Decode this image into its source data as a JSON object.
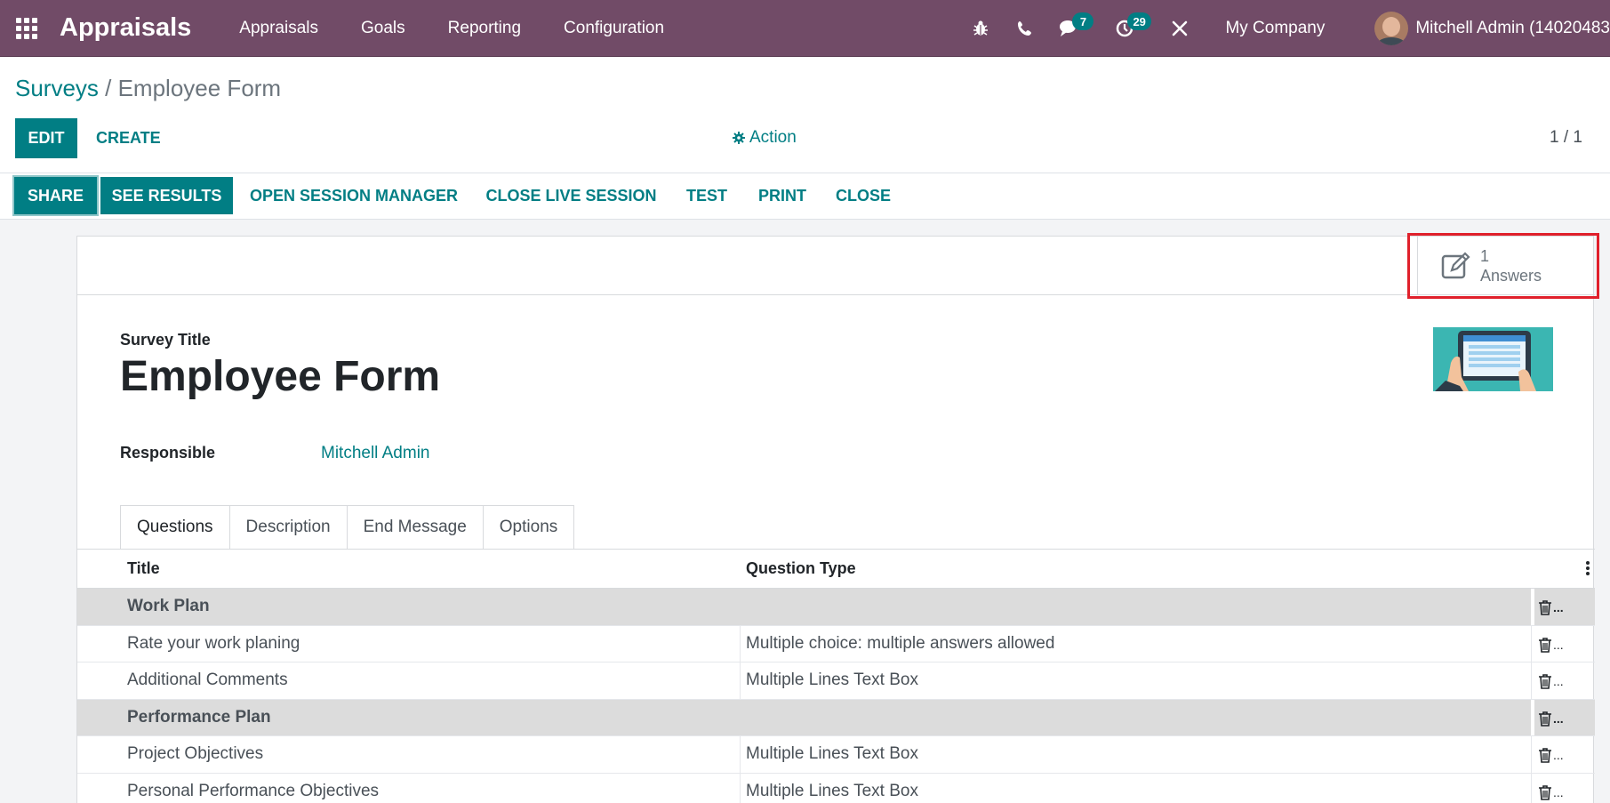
{
  "navbar": {
    "app_name": "Appraisals",
    "menu": [
      "Appraisals",
      "Goals",
      "Reporting",
      "Configuration"
    ],
    "messages_count": "7",
    "activities_count": "29",
    "company": "My Company",
    "user": "Mitchell Admin (14020483",
    "color": "#714b67"
  },
  "breadcrumb": {
    "parent": "Surveys",
    "separator": " / ",
    "current": "Employee Form"
  },
  "toolbar": {
    "edit_label": "EDIT",
    "create_label": "CREATE",
    "action_label": "Action",
    "pager": "1 / 1"
  },
  "statusbar": {
    "share": "SHARE",
    "see_results": "SEE RESULTS",
    "open_session_manager": "OPEN SESSION MANAGER",
    "close_live_session": "CLOSE LIVE SESSION",
    "test": "TEST",
    "print": "PRINT",
    "close": "CLOSE"
  },
  "stat_button": {
    "count": "1",
    "label": "Answers"
  },
  "form": {
    "survey_label": "Survey Title",
    "survey_title": "Employee Form",
    "responsible_label": "Responsible",
    "responsible_value": "Mitchell Admin"
  },
  "tabs": [
    "Questions",
    "Description",
    "End Message",
    "Options"
  ],
  "table": {
    "headers": {
      "title": "Title",
      "type": "Question Type"
    },
    "rows": [
      {
        "title": "Work Plan",
        "type": "",
        "section": true
      },
      {
        "title": "Rate your work planing",
        "type": "Multiple choice: multiple answers allowed",
        "section": false
      },
      {
        "title": "Additional Comments",
        "type": "Multiple Lines Text Box",
        "section": false
      },
      {
        "title": "Performance Plan",
        "type": "",
        "section": true
      },
      {
        "title": "Project Objectives",
        "type": "Multiple Lines Text Box",
        "section": false
      },
      {
        "title": "Personal Performance Objectives",
        "type": "Multiple Lines Text Box",
        "section": false
      }
    ]
  },
  "colors": {
    "accent": "#017e84",
    "highlight": "#e0202b"
  }
}
